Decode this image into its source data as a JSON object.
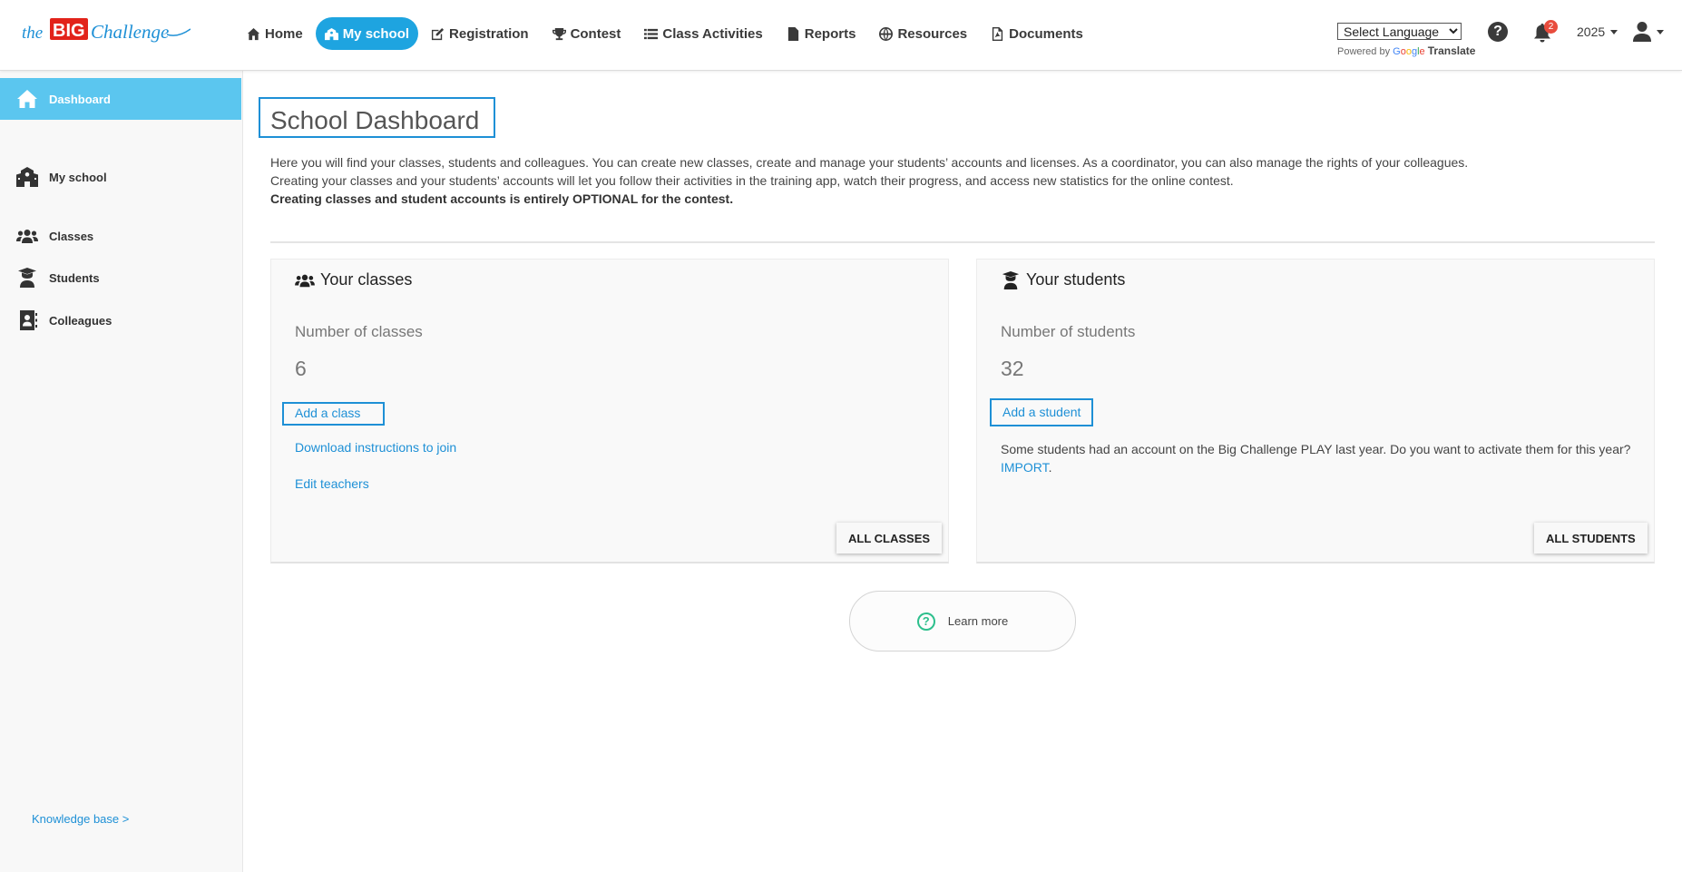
{
  "brand": {
    "logo_the": "the",
    "logo_big": "BIG",
    "logo_challenge": "Challenge"
  },
  "nav": [
    {
      "label": "Home",
      "icon": "home-icon"
    },
    {
      "label": "My school",
      "icon": "school-icon",
      "active": true
    },
    {
      "label": "Registration",
      "icon": "edit-icon"
    },
    {
      "label": "Contest",
      "icon": "trophy-icon"
    },
    {
      "label": "Class Activities",
      "icon": "list-icon"
    },
    {
      "label": "Reports",
      "icon": "report-icon"
    },
    {
      "label": "Resources",
      "icon": "globe-icon"
    },
    {
      "label": "Documents",
      "icon": "pdf-icon"
    }
  ],
  "translate": {
    "select_value": "Select Language",
    "powered_by": "Powered by",
    "google": [
      "G",
      "o",
      "o",
      "g",
      "l",
      "e"
    ],
    "translate_label": "Translate"
  },
  "header": {
    "help": "?",
    "notifications_count": "2",
    "year": "2025"
  },
  "sidebar": {
    "items": [
      {
        "label": "Dashboard",
        "icon": "home-icon",
        "active": true
      },
      {
        "label": "My school",
        "icon": "school-icon"
      },
      {
        "label": "Classes",
        "icon": "users-icon"
      },
      {
        "label": "Students",
        "icon": "graduate-icon"
      },
      {
        "label": "Colleagues",
        "icon": "address-book-icon"
      }
    ],
    "knowledge_base": "Knowledge base >"
  },
  "main": {
    "title": "School Dashboard",
    "intro_line1": "Here you will find your classes, students and colleagues. You can create new classes, create and manage your students’ accounts and licenses. As a coordinator, you can also manage the rights of your colleagues.",
    "intro_line2": "Creating your classes and your students’ accounts will let you follow their activities in the training app, watch their progress, and access new statistics for the online contest.",
    "intro_line3": "Creating classes and student accounts is entirely OPTIONAL for the contest."
  },
  "classes_card": {
    "title": "Your classes",
    "label": "Number of classes",
    "count": "6",
    "add_button": "Add a class",
    "download_link": "Download instructions to join",
    "edit_link": "Edit teachers",
    "all_button": "ALL CLASSES"
  },
  "students_card": {
    "title": "Your students",
    "label": "Number of students",
    "count": "32",
    "add_button": "Add a student",
    "import_text": "Some students had an account on the Big Challenge PLAY last year. Do you want to activate them for this year?",
    "import_link": "IMPORT",
    "import_end": ".",
    "all_button": "ALL STUDENTS"
  },
  "learn_more": {
    "icon": "?",
    "label": "Learn more"
  },
  "colors": {
    "accent": "#1ea4e0",
    "sidebar_active": "#5bc6ef",
    "link": "#1e90d6",
    "logo_red": "#e2231a",
    "learn_green": "#2cbf8c"
  }
}
